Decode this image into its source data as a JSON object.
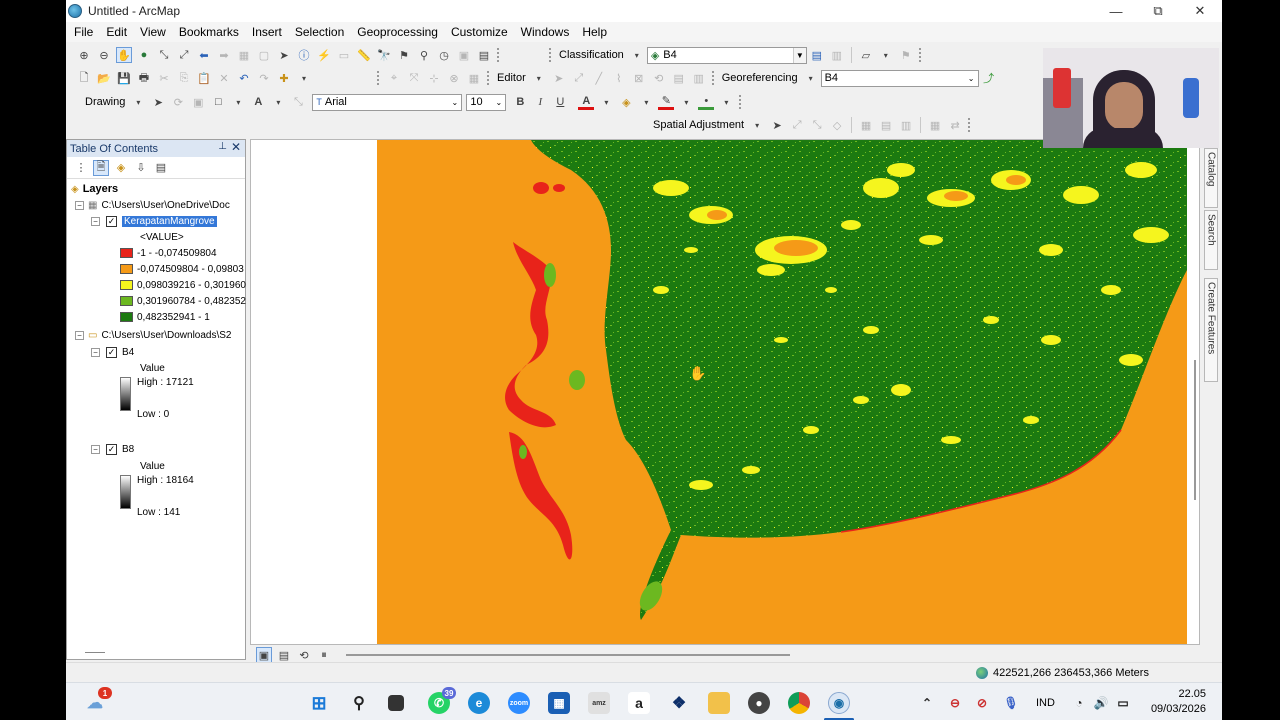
{
  "window": {
    "title": "Untitled - ArcMap",
    "minimize": "—",
    "maximize": "⧉",
    "close": "✕"
  },
  "menu": [
    "File",
    "Edit",
    "View",
    "Bookmarks",
    "Insert",
    "Selection",
    "Geoprocessing",
    "Customize",
    "Windows",
    "Help"
  ],
  "toolbar": {
    "classification_label": "Classification",
    "classification_layer": "B4",
    "editor_label": "Editor",
    "georeferencing_label": "Georeferencing",
    "georeferencing_layer": "B4",
    "drawing_label": "Drawing",
    "font_name": "Arial",
    "font_size": "10",
    "bold": "B",
    "italic": "I",
    "underline": "U",
    "font_color_glyph": "A",
    "spatial_adjustment_label": "Spatial Adjustment"
  },
  "toc": {
    "title": "Table Of Contents",
    "layers_label": "Layers",
    "group1_path": "C:\\Users\\User\\OneDrive\\Doc",
    "layer1_name": "KerapatanMangrove",
    "layer1_field": "<VALUE>",
    "classes": [
      {
        "label": "-1 - -0,074509804",
        "color": "#e8231a"
      },
      {
        "label": "-0,074509804 - 0,09803",
        "color": "#f59a17"
      },
      {
        "label": "0,098039216 - 0,301960",
        "color": "#f5f51e"
      },
      {
        "label": "0,301960784 - 0,482352",
        "color": "#6cb820"
      },
      {
        "label": "0,482352941 - 1",
        "color": "#1c7a10"
      }
    ],
    "group2_path": "C:\\Users\\User\\Downloads\\S2",
    "b4": {
      "name": "B4",
      "value_label": "Value",
      "high": "High : 17121",
      "low": "Low : 0"
    },
    "b8": {
      "name": "B8",
      "value_label": "Value",
      "high": "High : 18164",
      "low": "Low : 141"
    }
  },
  "side_tabs": [
    "Catalog",
    "Search",
    "Create Features"
  ],
  "status": {
    "coordinates": "422521,266  236453,366 Meters"
  },
  "taskbar": {
    "whatsapp_badge": "39",
    "weather_badge": "1",
    "language": "IND",
    "time": "22.05",
    "date": "09/03/2026"
  },
  "colors": {
    "water": "#f59a17",
    "dense": "#1c7a10",
    "medium": "#6cb820",
    "sparse": "#f5f51e",
    "nonveg": "#e8231a",
    "toc_header": "#dce6f3",
    "selection": "#3478d8"
  }
}
